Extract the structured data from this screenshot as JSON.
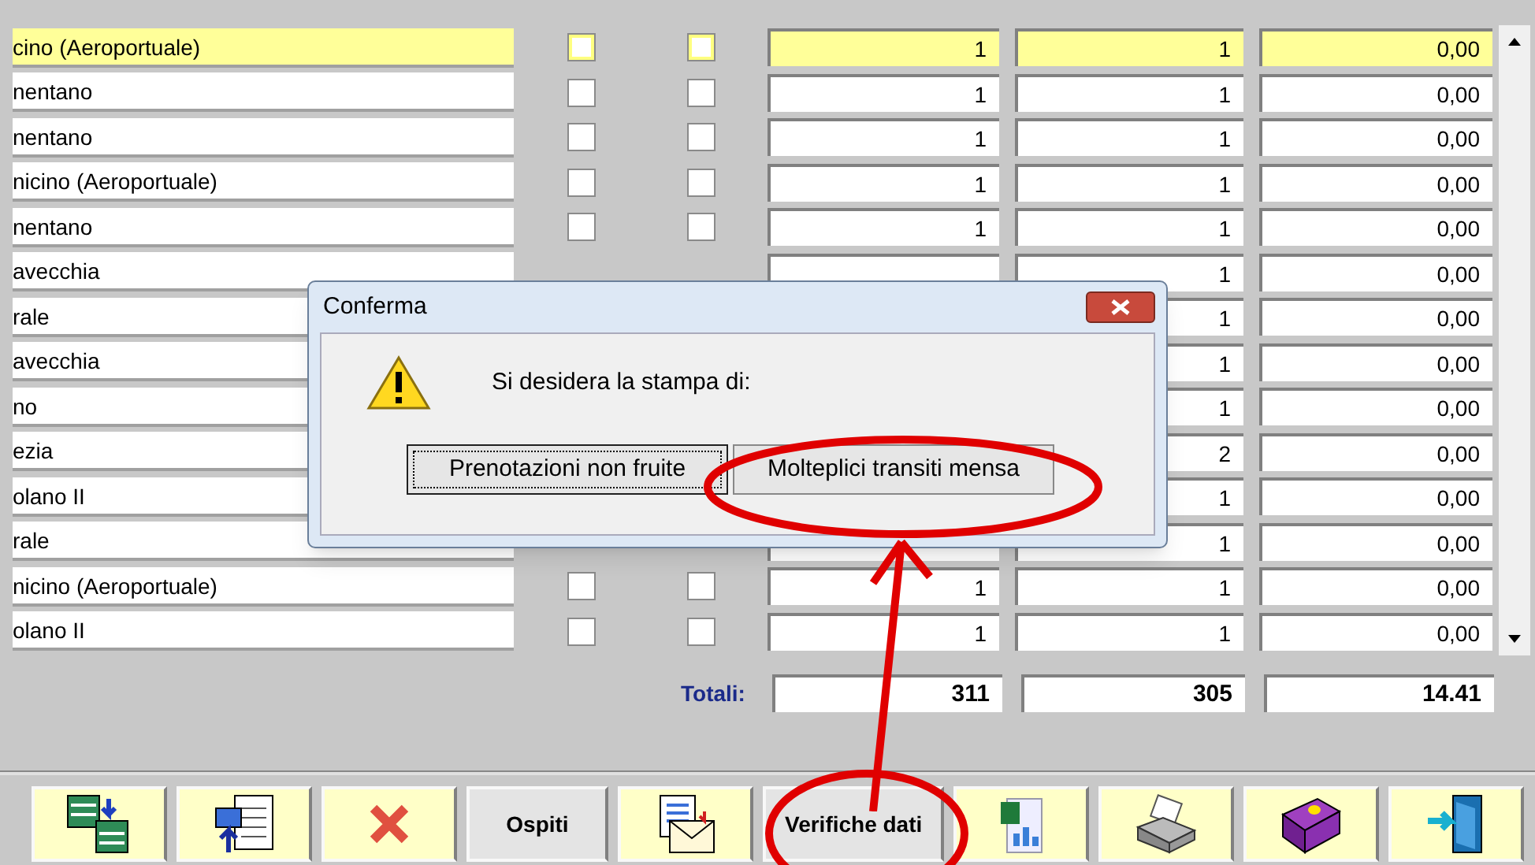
{
  "rows": [
    {
      "sede": "cino (Aeroportuale)",
      "selected": true,
      "check_1": false,
      "check_2": false,
      "col_3": "1",
      "col_4": "1",
      "col_5": "0,00"
    },
    {
      "sede": "nentano",
      "selected": false,
      "check_1": false,
      "check_2": false,
      "col_3": "1",
      "col_4": "1",
      "col_5": "0,00"
    },
    {
      "sede": "nentano",
      "selected": false,
      "check_1": false,
      "check_2": false,
      "col_3": "1",
      "col_4": "1",
      "col_5": "0,00"
    },
    {
      "sede": "nicino (Aeroportuale)",
      "selected": false,
      "check_1": false,
      "check_2": false,
      "col_3": "1",
      "col_4": "1",
      "col_5": "0,00"
    },
    {
      "sede": "nentano",
      "selected": false,
      "check_1": false,
      "check_2": false,
      "col_3": "1",
      "col_4": "1",
      "col_5": "0,00"
    },
    {
      "sede": "avecchia",
      "selected": false,
      "col_4": "1",
      "col_5": "0,00"
    },
    {
      "sede": "rale",
      "selected": false,
      "col_4": "1",
      "col_5": "0,00"
    },
    {
      "sede": "avecchia",
      "selected": false,
      "col_4": "1",
      "col_5": "0,00"
    },
    {
      "sede": "no",
      "selected": false,
      "col_4": "1",
      "col_5": "0,00"
    },
    {
      "sede": "ezia",
      "selected": false,
      "col_4": "2",
      "col_5": "0,00"
    },
    {
      "sede": "olano II",
      "selected": false,
      "col_4": "1",
      "col_5": "0,00"
    },
    {
      "sede": "rale",
      "selected": false,
      "col_4": "1",
      "col_5": "0,00"
    },
    {
      "sede": "nicino (Aeroportuale)",
      "selected": false,
      "check_1": false,
      "check_2": false,
      "col_3": "1",
      "col_4": "1",
      "col_5": "0,00"
    },
    {
      "sede": "olano II",
      "selected": false,
      "check_1": false,
      "check_2": false,
      "col_3": "1",
      "col_4": "1",
      "col_5": "0,00"
    }
  ],
  "totals": {
    "label": "Totali:",
    "col_3": "311",
    "col_4": "305",
    "col_5": "14.41"
  },
  "toolbar": [
    {
      "kind": "icon"
    },
    {
      "kind": "icon"
    },
    {
      "kind": "icon"
    },
    {
      "kind": "text",
      "label": "Ospiti"
    },
    {
      "kind": "icon"
    },
    {
      "kind": "text",
      "label": "Verifiche dati"
    },
    {
      "kind": "icon"
    },
    {
      "kind": "icon"
    },
    {
      "kind": "icon"
    },
    {
      "kind": "icon"
    }
  ],
  "dialog": {
    "title": "Conferma",
    "message": "Si desidera la stampa di:",
    "buttons": [
      {
        "label": "Prenotazioni non fruite",
        "focused": true
      },
      {
        "label": "Molteplici transiti mensa",
        "focused": false
      }
    ]
  }
}
